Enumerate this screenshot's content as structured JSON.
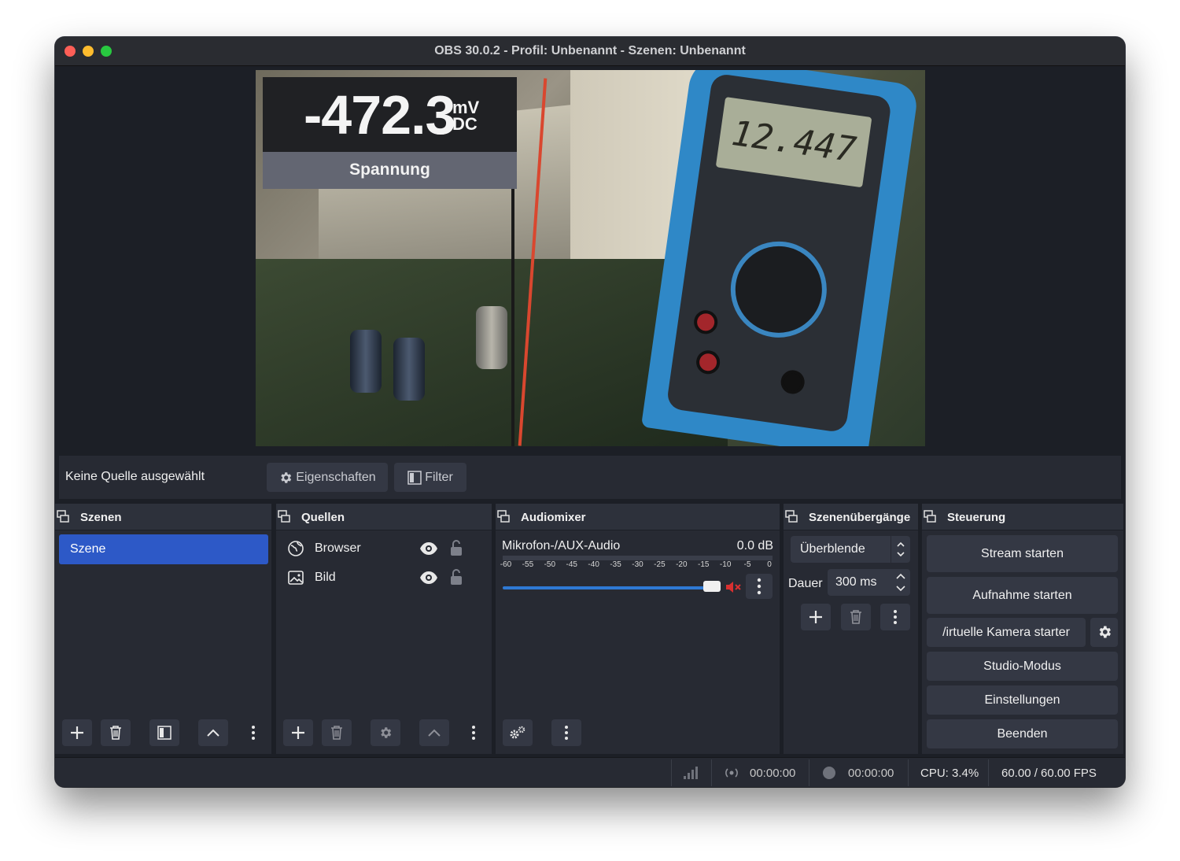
{
  "window": {
    "title": "OBS 30.0.2 - Profil: Unbenannt - Szenen: Unbenannt"
  },
  "preview": {
    "overlay_value": "-472.3",
    "overlay_unit_top": "mV",
    "overlay_unit_bottom": "DC",
    "overlay_label": "Spannung",
    "meter_display": "12.447"
  },
  "source_bar": {
    "status": "Keine Quelle ausgewählt",
    "properties_label": "Eigenschaften",
    "filter_label": "Filter"
  },
  "scenes": {
    "title": "Szenen",
    "items": [
      {
        "label": "Szene",
        "selected": true
      }
    ]
  },
  "sources": {
    "title": "Quellen",
    "items": [
      {
        "label": "Browser",
        "icon": "globe-icon"
      },
      {
        "label": "Bild",
        "icon": "image-icon"
      }
    ]
  },
  "audiomixer": {
    "title": "Audiomixer",
    "channel_name": "Mikrofon-/AUX-Audio",
    "level": "0.0 dB",
    "ticks": [
      "-60",
      "-55",
      "-50",
      "-45",
      "-40",
      "-35",
      "-30",
      "-25",
      "-20",
      "-15",
      "-10",
      "-5",
      "0"
    ],
    "volume_fraction": 1.0,
    "muted": true
  },
  "transitions": {
    "title": "Szenenübergänge",
    "selected": "Überblende",
    "duration_label": "Dauer",
    "duration_value": "300 ms"
  },
  "controls": {
    "title": "Steuerung",
    "stream": "Stream starten",
    "record": "Aufnahme starten",
    "virtual_cam": "/irtuelle Kamera starter",
    "studio": "Studio-Modus",
    "settings": "Einstellungen",
    "exit": "Beenden"
  },
  "status": {
    "stream_time": "00:00:00",
    "record_time": "00:00:00",
    "cpu": "CPU: 3.4%",
    "fps": "60.00 / 60.00 FPS"
  },
  "colors": {
    "accent": "#2d59c7",
    "window_bg": "#1c1f26",
    "panel_bg": "#272a33",
    "button_bg": "#343844",
    "mute_red": "#d93030"
  }
}
